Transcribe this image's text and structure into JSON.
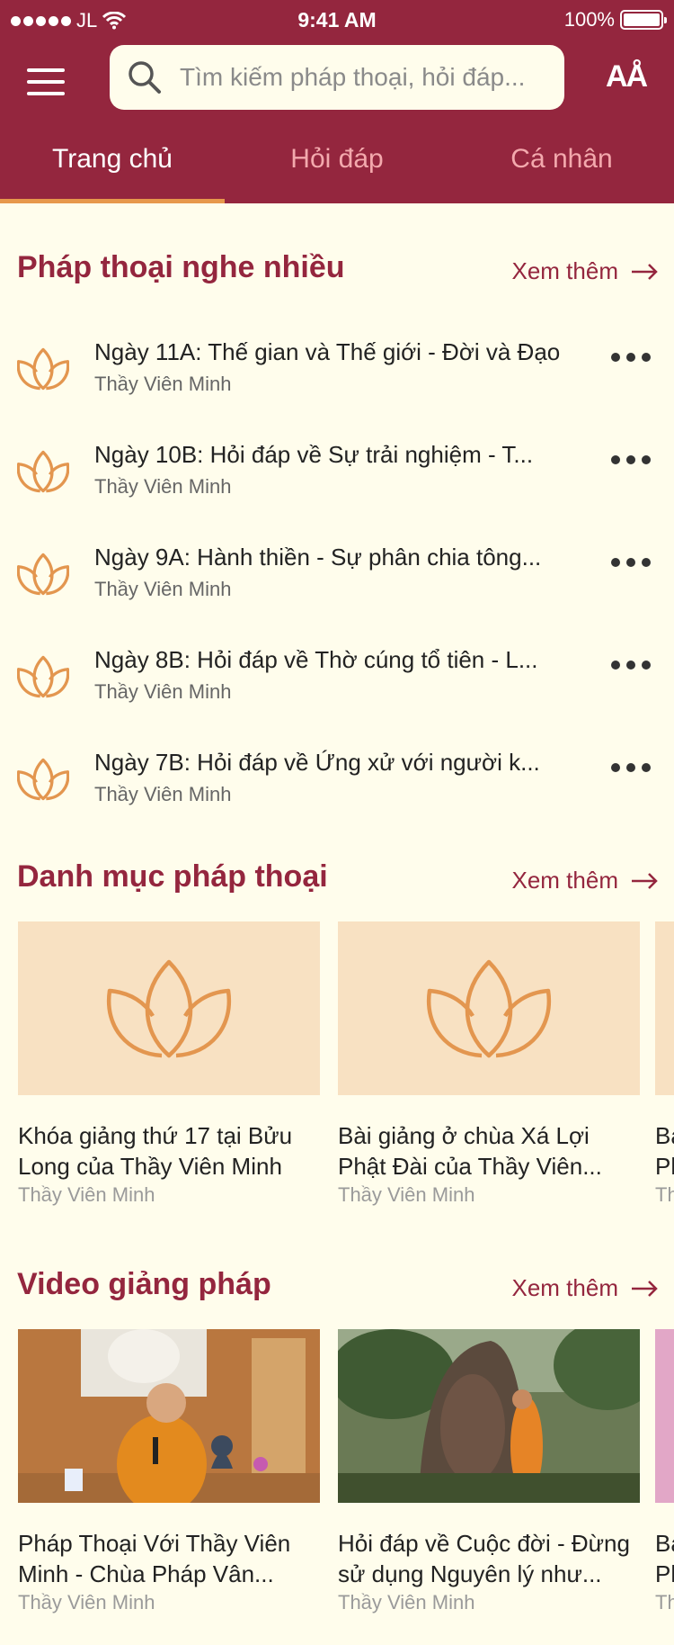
{
  "status_bar": {
    "carrier": "JL",
    "time": "9:41 AM",
    "battery": "100%"
  },
  "header": {
    "search_placeholder": "Tìm kiếm pháp thoại, hỏi đáp...",
    "font_button": "AÅ",
    "tabs": [
      {
        "label": "Trang chủ",
        "active": true
      },
      {
        "label": "Hỏi đáp",
        "active": false
      },
      {
        "label": "Cá nhân",
        "active": false
      }
    ]
  },
  "popular": {
    "title": "Pháp thoại nghe nhiều",
    "more": "Xem thêm",
    "items": [
      {
        "title": "Ngày 11A: Thế gian và Thế giới - Đời và Đạo",
        "author": "Thầy Viên Minh"
      },
      {
        "title": "Ngày 10B: Hỏi đáp về Sự trải nghiệm - T...",
        "author": "Thầy Viên Minh"
      },
      {
        "title": "Ngày 9A: Hành thiền - Sự phân chia tông...",
        "author": "Thầy Viên Minh"
      },
      {
        "title": "Ngày 8B: Hỏi đáp về Thờ cúng tổ tiên - L...",
        "author": "Thầy Viên Minh"
      },
      {
        "title": "Ngày 7B: Hỏi đáp về Ứng xử với người k...",
        "author": "Thầy Viên Minh"
      }
    ]
  },
  "categories": {
    "title": "Danh mục pháp thoại",
    "more": "Xem thêm",
    "cards": [
      {
        "title": "Khóa giảng thứ 17 tại Bửu Long của Thầy Viên Minh",
        "author": "Thầy Viên Minh"
      },
      {
        "title": "Bài giảng ở chùa Xá Lợi Phật Đài của Thầy Viên...",
        "author": "Thầy Viên Minh"
      }
    ],
    "peek": {
      "title1": "Ba",
      "title2": "Ph",
      "author": "Th"
    }
  },
  "videos": {
    "title": "Video giảng pháp",
    "more": "Xem thêm",
    "cards": [
      {
        "title": "Pháp Thoại Với Thầy Viên Minh - Chùa Pháp Vân...",
        "author": "Thầy Viên Minh"
      },
      {
        "title": "Hỏi đáp về Cuộc đời - Đừng sử dụng Nguyên lý như...",
        "author": "Thầy Viên Minh"
      }
    ],
    "peek": {
      "title1": "Ba",
      "title2": "Ph",
      "author": "Th"
    }
  },
  "colors": {
    "brand": "#94263e",
    "accent": "#e7984c",
    "background": "#fffdec",
    "card_bg": "#f8e1c2"
  }
}
